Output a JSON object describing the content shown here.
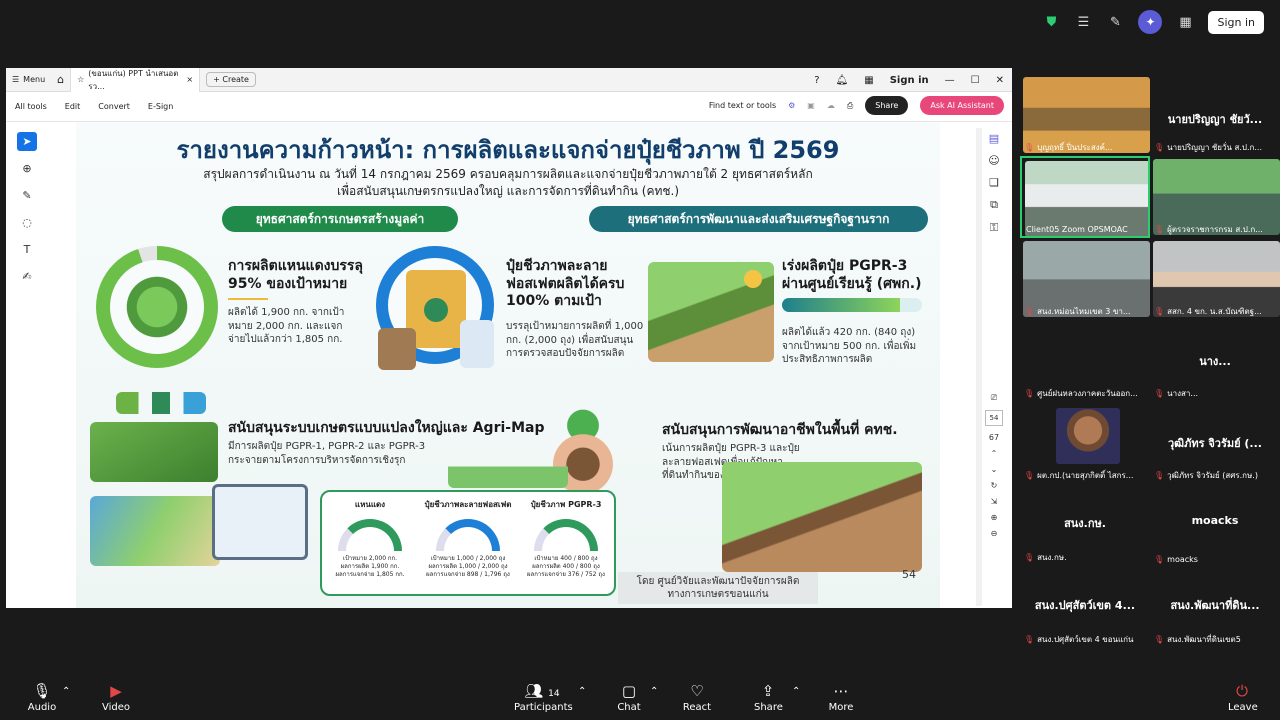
{
  "top_bar": {
    "signin_label": "Sign in"
  },
  "window": {
    "menu_label": "Menu",
    "tab_title": "(ขอนแก่น) PPT นำเสนอตรว...",
    "create_label": "Create",
    "signin_label": "Sign in",
    "menu_items": [
      "All tools",
      "Edit",
      "Convert",
      "E-Sign"
    ],
    "find_label": "Find text or tools",
    "share_label": "Share",
    "ai_label": "Ask AI Assistant",
    "page_current": "54",
    "page_total": "67"
  },
  "slide": {
    "title": "รายงานความก้าวหน้า: การผลิตและแจกจ่ายปุ๋ยชีวภาพ ปี 2569",
    "subtitle_1": "สรุปผลการดำเนินงาน ณ วันที่ 14 กรกฎาคม 2569 ครอบคลุมการผลิตและแจกจ่ายปุ๋ยชีวภาพภายใต้ 2 ยุทธศาสตร์หลัก",
    "subtitle_2": "เพื่อสนับสนุนเกษตรกรแปลงใหญ่ และการจัดการที่ดินทำกิน (คทช.)",
    "pill_left": "ยุทธศาสตร์การเกษตรสร้างมูลค่า",
    "pill_right": "ยุทธศาสตร์การพัฒนาและส่งเสริมเศรษฐกิจฐานราก",
    "b1_head": "การผลิตแหนแดงบรรลุ 95% ของเป้าหมาย",
    "b1_body": "ผลิตได้ 1,900 กก. จากเป้าหมาย 2,000 กก. และแจกจ่ายไปแล้วกว่า 1,805 กก.",
    "b2_head": "ปุ๋ยชีวภาพละลายฟอสเฟตผลิตได้ครบ 100% ตามเป้า",
    "b2_body": "บรรลุเป้าหมายการผลิตที่ 1,000 กก. (2,000 ถุง) เพื่อสนับสนุนการตรวจสอบปัจจัยการผลิต",
    "b3_head": "เร่งผลิตปุ๋ย PGPR-3 ผ่านศูนย์เรียนรู้ (ศพก.)",
    "b3_body": "ผลิตได้แล้ว 420 กก. (840 ถุง) จากเป้าหมาย 500 กก. เพื่อเพิ่มประสิทธิภาพการผลิต",
    "b4_head": "สนับสนุนระบบเกษตรแบบแปลงใหญ่และ Agri-Map",
    "b4_body": "มีการผลิตปุ๋ย PGPR-1, PGPR-2 และ PGPR-3 กระจายตามโครงการบริหารจัดการเชิงรุก",
    "b5_head": "สนับสนุนการพัฒนาอาชีพในพื้นที่ คทช.",
    "b5_body": "เน้นการผลิตปุ๋ย PGPR-3 และปุ๋ยละลายฟอสเฟตเพื่อแก้ปัญหาที่ดินทำกินของเกษตรกร",
    "gauges": [
      {
        "title": "แหนแดง",
        "l1": "เป้าหมาย 2,000 กก.",
        "l2": "ผลการผลิต 1,900 กก.",
        "l3": "ผลการแจกจ่าย 1,805 กก."
      },
      {
        "title": "ปุ๋ยชีวภาพละลายฟอสเฟต",
        "l1": "เป้าหมาย 1,000 / 2,000 ถุง",
        "l2": "ผลการผลิต 1,000 / 2,000 ถุง",
        "l3": "ผลการแจกจ่าย 898 / 1,796 ถุง"
      },
      {
        "title": "ปุ๋ยชีวภาพ PGPR-3",
        "l1": "เป้าหมาย 400 / 800 ถุง",
        "l2": "ผลการผลิต 400 / 800 ถุง",
        "l3": "ผลการแจกจ่าย 376 / 752 ถุง"
      }
    ],
    "credit": "โดย ศูนย์วิจัยและพัฒนาปัจจัยการผลิตทางการเกษตรขอนแก่น",
    "page_number": "54"
  },
  "participants": [
    {
      "name": "บุญฤทธิ์ ปิ่นประสงค์...",
      "big": "",
      "video": true
    },
    {
      "name": "นายปริญญา ชัยวั่น ส.ป.ก...",
      "big": "นายปริญญา ชัยวั...",
      "video": false
    },
    {
      "name": "Client05 Zoom OPSMOAC",
      "big": "",
      "video": true
    },
    {
      "name": "ผู้ตรวจราชการกรม ส.ป.ก...",
      "big": "",
      "video": true
    },
    {
      "name": "สนง.หม่อนไหมเขต 3 ขา...",
      "big": "",
      "video": true
    },
    {
      "name": "สสก. 4 ขก. น.ส.บัณฑิตฐ...",
      "big": "",
      "video": true
    },
    {
      "name": "ศูนย์ฝนหลวงภาคตะวันออก...",
      "big": "",
      "video": false
    },
    {
      "name": "นางสา...",
      "big": "นาง...",
      "video": false
    },
    {
      "name": "ผต.กป.(นายสุภกิตติ์ ไสกร...",
      "big": "",
      "video": true
    },
    {
      "name": "วุฒิภัทร จิวรัมย์ (สศร.กษ.)",
      "big": "วุฒิภัทร จิวรัมย์ (...",
      "video": false
    },
    {
      "name": "สนง.กษ.",
      "big": "สนง.กษ.",
      "video": false
    },
    {
      "name": "moacks",
      "big": "moacks",
      "video": false
    },
    {
      "name": "สนง.ปศุสัตว์เขต 4 ขอนแก่น",
      "big": "สนง.ปศุสัตว์เขต 4...",
      "video": false
    },
    {
      "name": "สนง.พัฒนาที่ดินเขต5",
      "big": "สนง.พัฒนาที่ดิน...",
      "video": false
    }
  ],
  "bottom": {
    "audio": "Audio",
    "video": "Video",
    "participants": "Participants",
    "participants_count": "14",
    "chat": "Chat",
    "react": "React",
    "share": "Share",
    "more": "More",
    "leave": "Leave"
  }
}
